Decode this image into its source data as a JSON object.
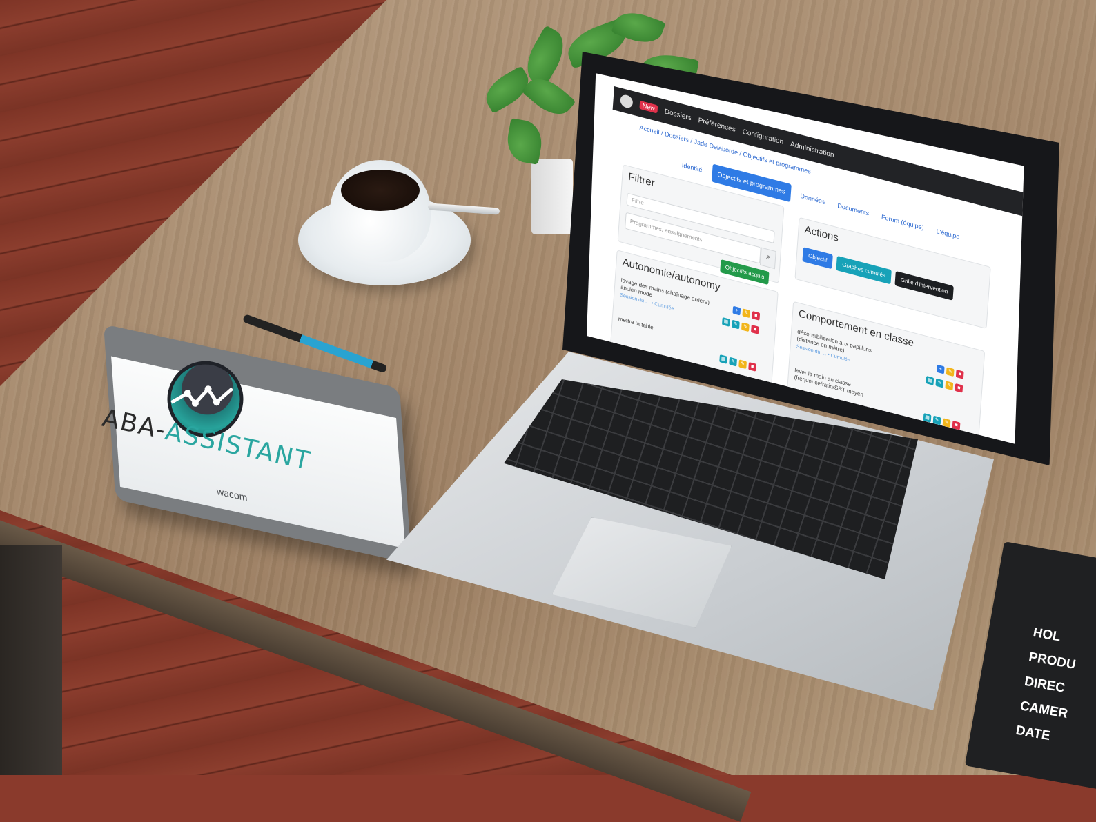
{
  "tablet": {
    "logo_left": "ABA-",
    "logo_right": "ASSISTANT",
    "brand": "wacom"
  },
  "app": {
    "nav": {
      "badge": "New",
      "items": [
        "Dossiers",
        "Préférences",
        "Configuration",
        "Administration"
      ]
    },
    "breadcrumb": "Accueil / Dossiers / Jade Delaborde / Objectifs et programmes",
    "tabs": [
      "Identité",
      "Objectifs et programmes",
      "Données",
      "Documents",
      "Forum (équipe)",
      "L'équipe"
    ],
    "active_tab_index": 1,
    "filter": {
      "title": "Filtrer",
      "filter_placeholder": "Filtre",
      "search_placeholder": "Programmes, enseignements",
      "search_icon": "magnifier-icon",
      "green_button": "Objectifs acquis"
    },
    "actions": {
      "title": "Actions",
      "buttons": [
        {
          "label": "Objectif",
          "color": "#2f7be5"
        },
        {
          "label": "Graphes cumulés",
          "color": "#17a2b8"
        },
        {
          "label": "Grille d'intervention",
          "color": "#1d1f22"
        }
      ]
    },
    "autonomie": {
      "title": "Autonomie/autonomy",
      "goals": [
        {
          "text": "lavage des mains (chaînage arrière) ancien mode",
          "meta": "Session du … • Cumulée"
        },
        {
          "text": "mettre la table",
          "meta": ""
        }
      ]
    },
    "comportement": {
      "title": "Comportement en classe",
      "goals": [
        {
          "text": "désensibilisation aux papillons (distance en mètre)",
          "meta": "Session du … • Cumulée"
        },
        {
          "text": "lever la main en classe (fréquence/ratio/SRT moyen",
          "meta": ""
        }
      ]
    }
  },
  "clapper": {
    "lines": [
      "HOL",
      "PRODU",
      "DIREC",
      "CAMER",
      "DATE"
    ]
  },
  "colors": {
    "navbar": "#222326",
    "primary": "#2f7be5",
    "green": "#239a4a",
    "info": "#17a2b8",
    "warning": "#f2b51b",
    "danger": "#e0314b",
    "teal": "#2aa6a0"
  }
}
